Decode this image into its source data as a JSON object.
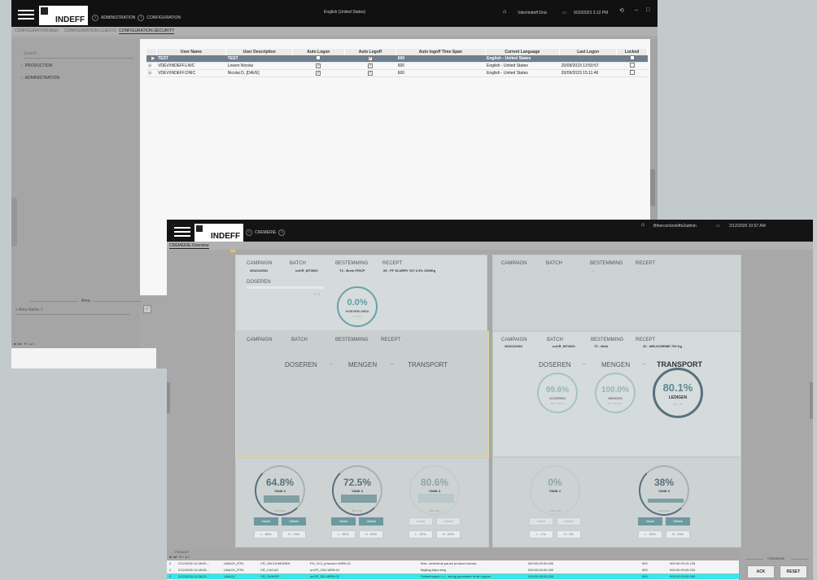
{
  "back_window": {
    "logo_text": "INDEFF",
    "breadcrumb": [
      "ADMINISTRATION",
      "CONFIGURATION"
    ],
    "language": "English (United States)",
    "user": "Vdev\\indeff.Dnic",
    "datetime": "9/20/2023 3:12 PM",
    "tabs": [
      "CONFIGURATION.Main",
      "CONFIGURATION.CLIENTS",
      "CONFIGURATION.SECURITY"
    ],
    "search_placeholder": "Search...",
    "tree": [
      "PRODUCTION",
      "ADMINISTRATION"
    ],
    "table": {
      "columns": [
        "User Name",
        "User Description",
        "Auto Logon",
        "Auto Logoff",
        "Auto logoff Time Span",
        "Current Language",
        "Last Logon",
        "Locked"
      ],
      "rows": [
        {
          "user": "TEST",
          "desc": "TEST",
          "auto_logon": false,
          "auto_logoff": true,
          "span": "600",
          "lang": "English - United States",
          "last": "",
          "locked": false,
          "selected": true
        },
        {
          "user": "VDEV\\INDEFF.LNIC",
          "desc": "Lowen Nicolai",
          "auto_logon": true,
          "auto_logoff": true,
          "span": "600",
          "lang": "English - United States",
          "last": "20/09/2023 13:50:57",
          "locked": false,
          "selected": false
        },
        {
          "user": "VDEV\\INDEFF.DNIC",
          "desc": "Nicolai D. [DAVE]",
          "auto_logon": true,
          "auto_logoff": true,
          "span": "600",
          "lang": "English - United States",
          "last": "20/09/2023 15:11:46",
          "locked": false,
          "selected": false
        }
      ]
    },
    "area_title": "Area",
    "area_name_placeholder": "< Area Name >",
    "counts": "■0  ■0  ▼0  ▲0"
  },
  "front_window": {
    "logo_text": "INDEFF",
    "breadcrumb": "CREMERIE",
    "user": "Bthercon\\indeffa2admin",
    "datetime": "2/12/2026 10:57 AM",
    "tab": "CREMERIE.Overview",
    "labels": {
      "campaign": "CAMPAIGN",
      "batch": "BATCH",
      "bestemming": "BESTEMMING",
      "recept": "RECEPT"
    },
    "panels": {
      "p1": {
        "campaign": "2602120001",
        "batch": "unCR_MT3002",
        "bestemming": "T3 - Brein FR/CP",
        "recept": "05 - PF SLURRY V37 0.3% 1500Kg",
        "doseren": "DOSEREN",
        "progress_text": "0 / 1",
        "progress": 0.0,
        "gauge_pct": "0.0%",
        "gauge_lbl": "HOEVEELHEID",
        "gauge_sub": "0 / 96 kg"
      },
      "p2": {
        "campaign": "-",
        "batch": "-",
        "bestemming": "-",
        "recept": "-"
      },
      "p3": {
        "campaign": "-",
        "batch": "-",
        "bestemming": "-",
        "recept": "-",
        "stages": [
          "DOSEREN",
          "MENGEN",
          "TRANSPORT"
        ]
      },
      "p4": {
        "campaign": "2602120001",
        "batch": "unCR_MT4020",
        "bestemming": "T2 - Melk",
        "recept": "20 - MELKCREME 700 Kg",
        "stages": [
          "DOSEREN",
          "MENGEN",
          "TRANSPORT"
        ],
        "g1": {
          "pct": "99.6%",
          "lbl": "DOSEREN",
          "sub": "697 / 700 kg"
        },
        "g2": {
          "pct": "100.0%",
          "lbl": "MENGEN",
          "sub": "300 / 300 sec"
        },
        "g3": {
          "pct": "80.1%",
          "lbl": "LEDIGEN",
          "sub": "560 / 700"
        }
      }
    },
    "tanks": [
      {
        "pct": "64.8%",
        "name": "TANK 2",
        "fill": 0.648,
        "ticks": "70%   90%",
        "inlaat": "Inlaat",
        "uitlaat": "Uitlaat",
        "l": "L : 65%",
        "h": "H : 70%",
        "active": true
      },
      {
        "pct": "72.5%",
        "name": "TANK 3",
        "fill": 0.725,
        "ticks": "80%   70%",
        "inlaat": "Inlaat",
        "uitlaat": "Uitlaat",
        "l": "L : 60%",
        "h": "H : 65%",
        "active": true
      },
      {
        "pct": "80.6%",
        "name": "TANK 4",
        "fill": 0.806,
        "ticks": "80%   70%",
        "inlaat": "Inlaat",
        "uitlaat": "Uitlaat",
        "l": "L : 60%",
        "h": "H : 65%",
        "active": false
      },
      {
        "pct": "0%",
        "name": "TANK 1",
        "fill": 0.0,
        "ticks": "1.0%   2.0%",
        "inlaat": "Inlaat",
        "uitlaat": "Uitlaat",
        "l": "L : 1%",
        "h": "H : 3%",
        "active": false
      },
      {
        "pct": "38%",
        "name": "TANK 2",
        "fill": 0.38,
        "ticks": "20%   40%",
        "inlaat": "Inlaat",
        "uitlaat": "Uitlaat",
        "l": "L : 30%",
        "h": "H : 20%",
        "active": true
      }
    ],
    "alarm_header": "PRIMAIR",
    "alarm_counts": "■0  ■0  ▼0  ▲0",
    "alarms": [
      {
        "n": "2",
        "time": "2/12/2026 10:48:00...",
        "state": "UNACK_RTN",
        "tag": "CR_VACUUMUNEN",
        "src": "PH_VL3_pVacuum.WRN.01",
        "msg": "Max. onderdruk pauze product toevoer",
        "t1": "000:00:00:00.000",
        "v": "500",
        "t2": "000:00:00:19.128"
      },
      {
        "n": "2",
        "time": "2/12/2026 10:45:08...",
        "state": "UNACK_RTN",
        "tag": "CR_CACAO",
        "src": "unCR_CB1.WRN.01",
        "msg": "BigBag bijna leeg",
        "t1": "000:00:00:00.000",
        "v": "500",
        "t2": "000:00:00:09.203"
      },
      {
        "n": "2",
        "time": "2/12/2026 10:36:23...",
        "state": "UNACK",
        "tag": "CR_SUIKER",
        "src": "unCR_S01.WRN.02",
        "msg": "Suikerhopper: L.L. bruug gevonden in de hopper",
        "t1": "000:00:00:00.000",
        "v": "500",
        "t2": "000:00:00:00.000"
      }
    ],
    "side_title": "CREMERIE",
    "ack": "ACK",
    "reset": "RESET"
  }
}
